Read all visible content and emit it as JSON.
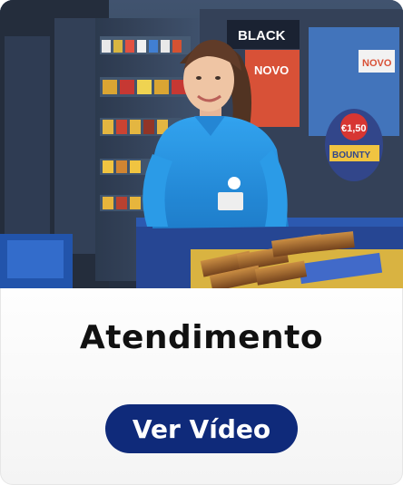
{
  "card": {
    "title": "Atendimento",
    "button_label": "Ver Vídeo"
  },
  "photo": {
    "alt": "Atendente sorridente de camisa polo azul atrás do balcão de uma loja de conveniência",
    "signs": {
      "black": "BLACK",
      "novo_left": "NOVO",
      "novo_right": "NOVO",
      "price_badge": "€1,50",
      "bounty_label": "BOUNTY"
    }
  },
  "colors": {
    "button_bg": "#0f2a7a",
    "button_text": "#ffffff",
    "title_text": "#111111",
    "shirt_blue": "#1f8ee0"
  }
}
